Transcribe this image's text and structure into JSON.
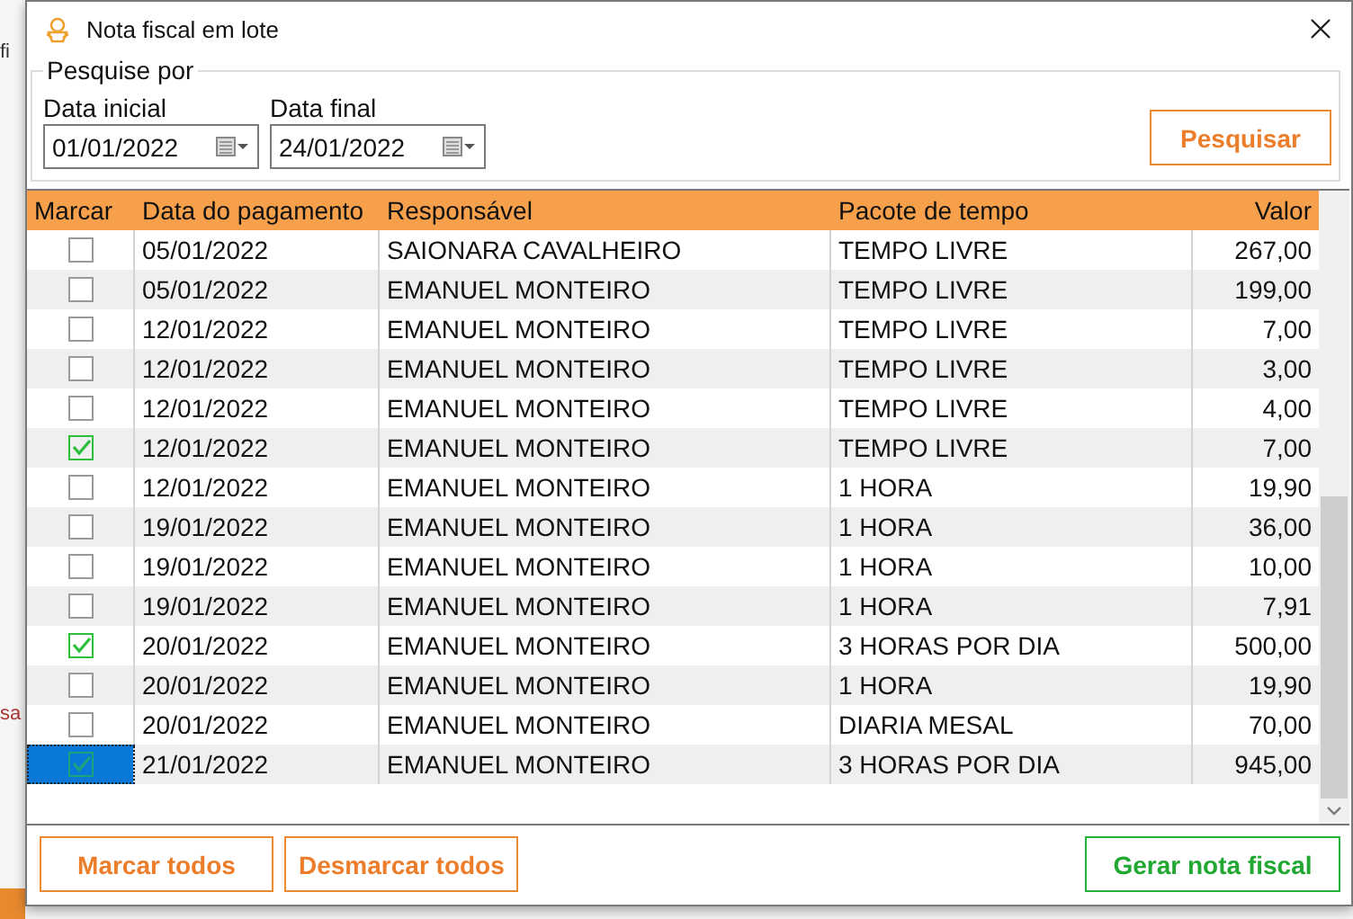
{
  "background_fragments": [
    "fi",
    "sa"
  ],
  "window": {
    "title": "Nota fiscal em lote"
  },
  "search_group": {
    "title": "Pesquise por",
    "fields": [
      {
        "label": "Data inicial",
        "value": "01/01/2022"
      },
      {
        "label": "Data final",
        "value": "24/01/2022"
      }
    ],
    "button": "Pesquisar"
  },
  "table": {
    "columns": [
      "Marcar",
      "Data do pagamento",
      "Responsável",
      "Pacote de tempo",
      "Valor"
    ],
    "rows": [
      {
        "checked": false,
        "selected": false,
        "date": "05/01/2022",
        "person": "SAIONARA CAVALHEIRO",
        "package": "TEMPO LIVRE",
        "value": "267,00"
      },
      {
        "checked": false,
        "selected": false,
        "date": "05/01/2022",
        "person": "EMANUEL MONTEIRO",
        "package": "TEMPO LIVRE",
        "value": "199,00"
      },
      {
        "checked": false,
        "selected": false,
        "date": "12/01/2022",
        "person": "EMANUEL MONTEIRO",
        "package": "TEMPO LIVRE",
        "value": "7,00"
      },
      {
        "checked": false,
        "selected": false,
        "date": "12/01/2022",
        "person": "EMANUEL MONTEIRO",
        "package": "TEMPO LIVRE",
        "value": "3,00"
      },
      {
        "checked": false,
        "selected": false,
        "date": "12/01/2022",
        "person": "EMANUEL MONTEIRO",
        "package": "TEMPO LIVRE",
        "value": "4,00"
      },
      {
        "checked": true,
        "selected": false,
        "date": "12/01/2022",
        "person": "EMANUEL MONTEIRO",
        "package": "TEMPO LIVRE",
        "value": "7,00"
      },
      {
        "checked": false,
        "selected": false,
        "date": "12/01/2022",
        "person": "EMANUEL MONTEIRO",
        "package": "1 HORA",
        "value": "19,90"
      },
      {
        "checked": false,
        "selected": false,
        "date": "19/01/2022",
        "person": "EMANUEL MONTEIRO",
        "package": "1 HORA",
        "value": "36,00"
      },
      {
        "checked": false,
        "selected": false,
        "date": "19/01/2022",
        "person": "EMANUEL MONTEIRO",
        "package": "1 HORA",
        "value": "10,00"
      },
      {
        "checked": false,
        "selected": false,
        "date": "19/01/2022",
        "person": "EMANUEL MONTEIRO",
        "package": "1 HORA",
        "value": "7,91"
      },
      {
        "checked": true,
        "selected": false,
        "date": "20/01/2022",
        "person": "EMANUEL MONTEIRO",
        "package": "3 HORAS POR DIA",
        "value": "500,00"
      },
      {
        "checked": false,
        "selected": false,
        "date": "20/01/2022",
        "person": "EMANUEL MONTEIRO",
        "package": "1 HORA",
        "value": "19,90"
      },
      {
        "checked": false,
        "selected": false,
        "date": "20/01/2022",
        "person": "EMANUEL MONTEIRO",
        "package": "DIARIA MESAL",
        "value": "70,00"
      },
      {
        "checked": true,
        "selected": true,
        "date": "21/01/2022",
        "person": "EMANUEL MONTEIRO",
        "package": "3 HORAS POR DIA",
        "value": "945,00"
      }
    ]
  },
  "footer_buttons": [
    {
      "label": "Marcar todos",
      "kind": "secondary"
    },
    {
      "label": "Desmarcar todos",
      "kind": "secondary"
    },
    {
      "label": "Gerar nota fiscal",
      "kind": "primary"
    }
  ]
}
